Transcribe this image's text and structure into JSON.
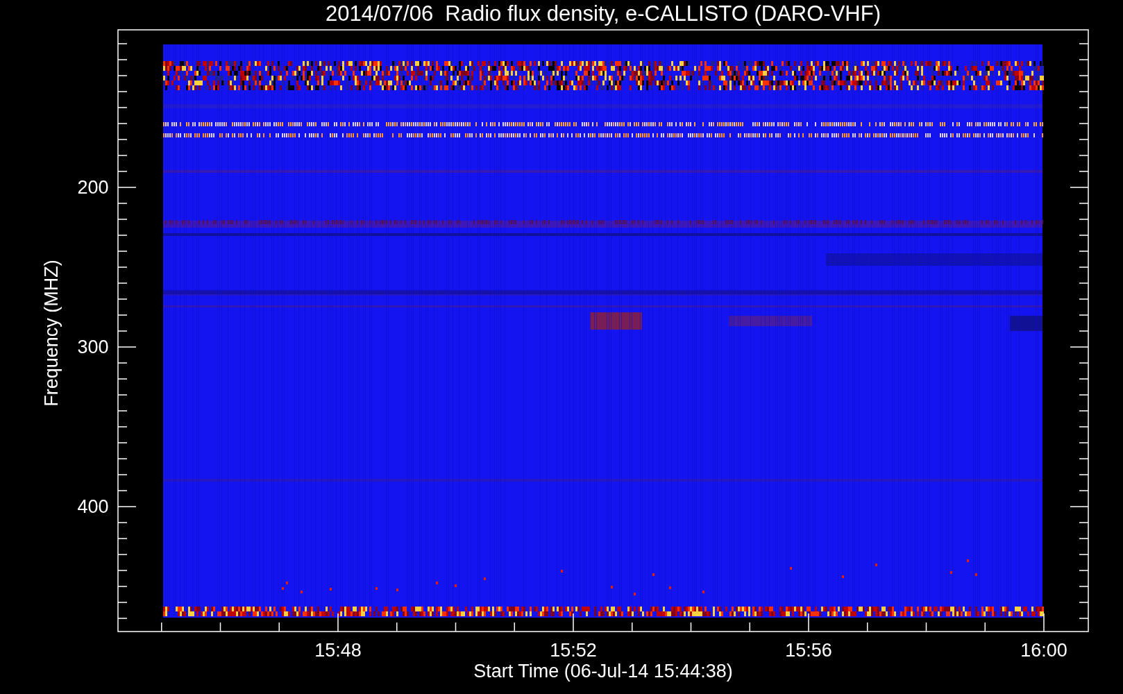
{
  "title": "2014/07/06  Radio flux density, e-CALLISTO (DARO-VHF)",
  "y_axis": {
    "label": "Frequency (MHZ)",
    "ticks": [
      "200",
      "300",
      "400"
    ]
  },
  "x_axis": {
    "label": "Start Time (06-Jul-14 15:44:38)",
    "ticks": [
      "15:48",
      "15:52",
      "15:56",
      "16:00"
    ]
  }
}
